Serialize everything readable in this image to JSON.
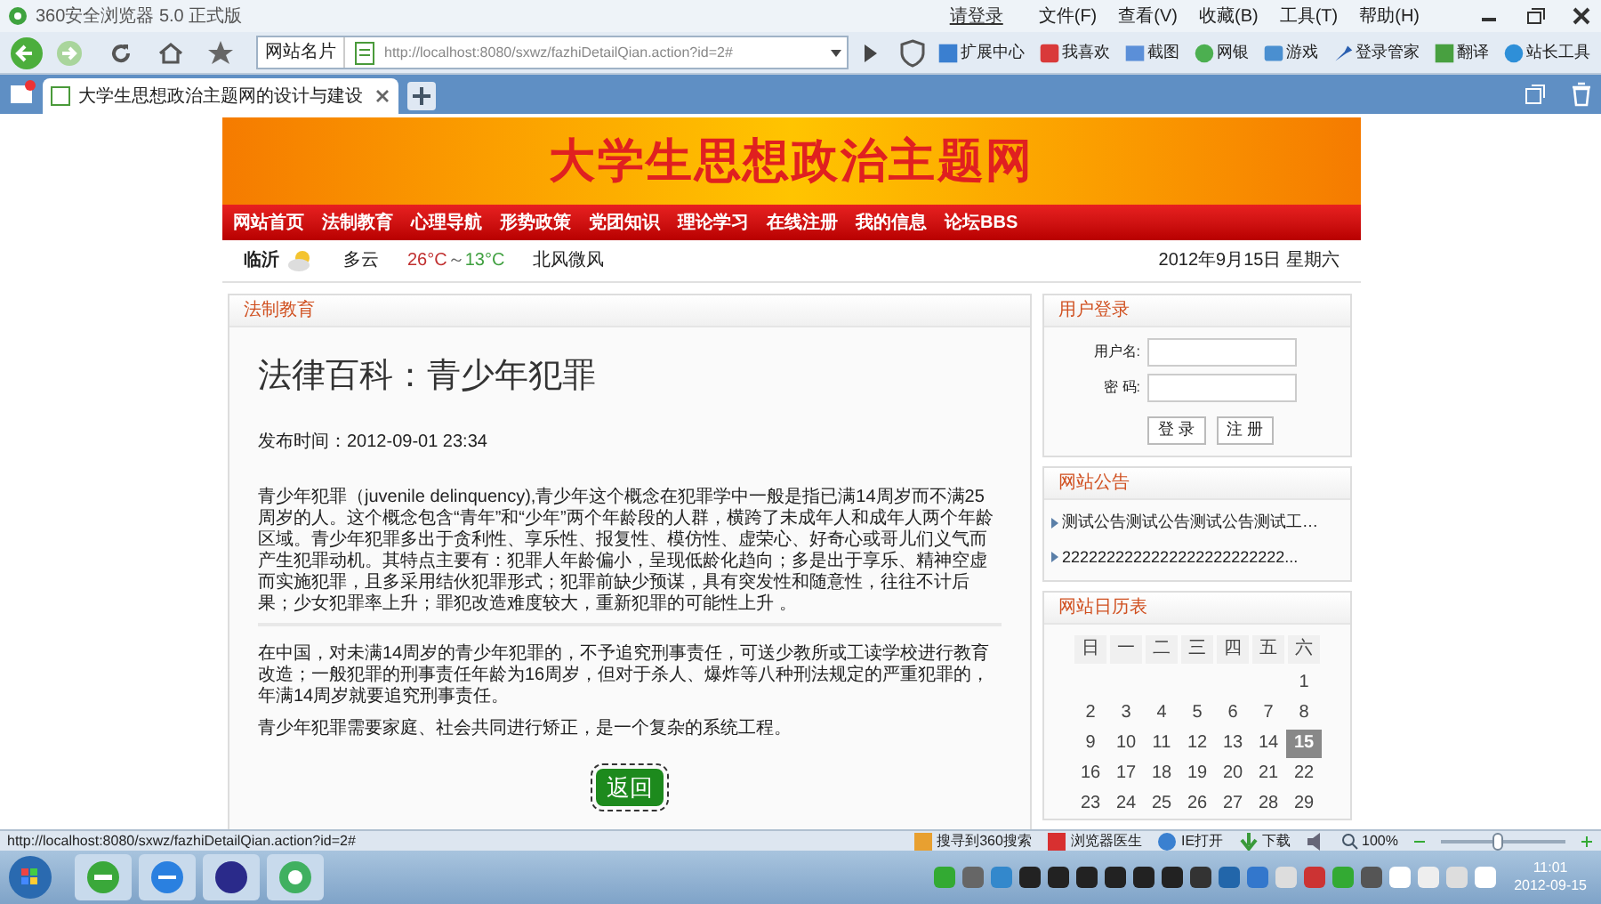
{
  "window": {
    "title": "360安全浏览器 5.0 正式版",
    "login_link": "请登录",
    "menu": [
      "文件(F)",
      "查看(V)",
      "收藏(B)",
      "工具(T)",
      "帮助(H)"
    ]
  },
  "toolbar": {
    "site_card": "网站名片",
    "url": "http://localhost:8080/sxwz/fazhiDetailQian.action?id=2#",
    "extensions": [
      "扩展中心",
      "我喜欢",
      "截图",
      "网银",
      "游戏",
      "登录管家",
      "翻译",
      "站长工具"
    ]
  },
  "tabs": [
    {
      "label": "大学生思想政治主题网的设计与建设",
      "selected": true
    }
  ],
  "site": {
    "title": "大学生思想政治主题网",
    "nav": [
      "网站首页",
      "法制教育",
      "心理导航",
      "形势政策",
      "党团知识",
      "理论学习",
      "在线注册",
      "我的信息",
      "论坛BBS"
    ],
    "weather": {
      "city": "临沂",
      "sky": "多云",
      "temp_high": "26°C",
      "separator": "～",
      "temp_low": "13°C",
      "wind": "北风微风"
    },
    "date": "2012年9月15日 星期六"
  },
  "article": {
    "section": "法制教育",
    "title": "法律百科：青少年犯罪",
    "published": "发布时间：2012-09-01 23:34",
    "paragraphs": [
      "青少年犯罪（juvenile delinquency),青少年这个概念在犯罪学中一般是指已满14周岁而不满25周岁的人。这个概念包含“青年”和“少年”两个年龄段的人群，横跨了未成年人和成年人两个年龄区域。青少年犯罪多出于贪利性、享乐性、报复性、模仿性、虚荣心、好奇心或哥儿们义气而产生犯罪动机。其特点主要有：犯罪人年龄偏小，呈现低龄化趋向；多是出于享乐、精神空虚而实施犯罪，且多采用结伙犯罪形式；犯罪前缺少预谋，具有突发性和随意性，往往不计后果；少女犯罪率上升；罪犯改造难度较大，重新犯罪的可能性上升 。",
      "在中国，对未满14周岁的青少年犯罪的，不予追究刑事责任，可送少教所或工读学校进行教育改造；一般犯罪的刑事责任年龄为16周岁，但对于杀人、爆炸等八种刑法规定的严重犯罪的，年满14周岁就要追究刑事责任。",
      "青少年犯罪需要家庭、社会共同进行矫正，是一个复杂的系统工程。"
    ],
    "back_button": "返回"
  },
  "login": {
    "title": "用户登录",
    "username_label": "用户名:",
    "password_label": "密 码:",
    "buttons": [
      "登 录",
      "注 册"
    ]
  },
  "notices": {
    "title": "网站公告",
    "items": [
      "测试公告测试公告测试公告测试工…",
      "2222222222222222222222222..."
    ]
  },
  "calendar": {
    "title": "网站日历表",
    "weekdays": [
      "日",
      "一",
      "二",
      "三",
      "四",
      "五",
      "六"
    ],
    "weeks": [
      [
        {
          "day": "1",
          "selected": false
        }
      ],
      [
        {
          "day": "2",
          "selected": false
        },
        {
          "day": "3",
          "selected": false
        },
        {
          "day": "4",
          "selected": false
        },
        {
          "day": "5",
          "selected": false
        },
        {
          "day": "6",
          "selected": false
        },
        {
          "day": "7",
          "selected": false
        },
        {
          "day": "8",
          "selected": false
        }
      ],
      [
        {
          "day": "9",
          "selected": false
        },
        {
          "day": "10",
          "selected": false
        },
        {
          "day": "11",
          "selected": false
        },
        {
          "day": "12",
          "selected": false
        },
        {
          "day": "13",
          "selected": false
        },
        {
          "day": "14",
          "selected": false
        },
        {
          "day": "15",
          "selected": true
        }
      ],
      [
        {
          "day": "16",
          "selected": false
        },
        {
          "day": "17",
          "selected": false
        },
        {
          "day": "18",
          "selected": false
        },
        {
          "day": "19",
          "selected": false
        },
        {
          "day": "20",
          "selected": false
        },
        {
          "day": "21",
          "selected": false
        },
        {
          "day": "22",
          "selected": false
        }
      ],
      [
        {
          "day": "23",
          "selected": false
        },
        {
          "day": "24",
          "selected": false
        },
        {
          "day": "25",
          "selected": false
        },
        {
          "day": "26",
          "selected": false
        },
        {
          "day": "27",
          "selected": false
        },
        {
          "day": "28",
          "selected": false
        },
        {
          "day": "29",
          "selected": false
        }
      ]
    ]
  },
  "status_bar": {
    "url": "http://localhost:8080/sxwz/fazhiDetailQian.action?id=2#",
    "items": [
      "搜寻到360搜索",
      "浏览器医生",
      "IE打开",
      "下载"
    ],
    "zoom": "100%",
    "zoom_slider": {
      "level": 0.45
    }
  },
  "taskbar": {
    "time": "11:01",
    "date": "2012-09-15"
  }
}
